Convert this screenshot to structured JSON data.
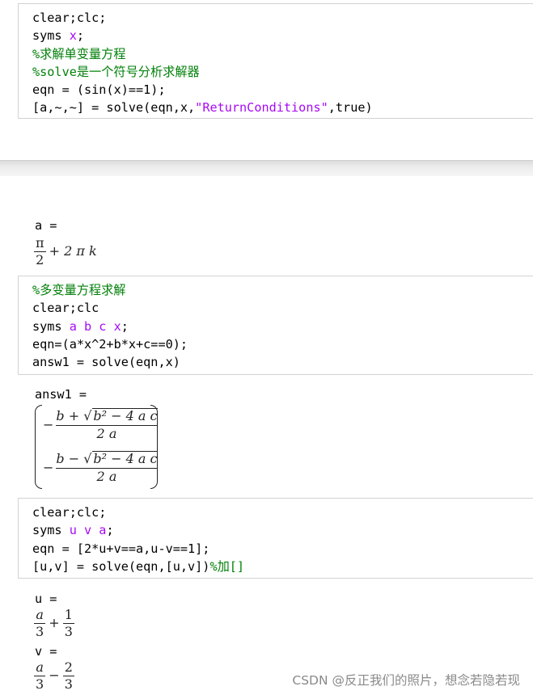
{
  "cell1": {
    "lines": [
      {
        "parts": [
          {
            "t": "clear;clc;",
            "c": ""
          }
        ]
      },
      {
        "parts": [
          {
            "t": "syms ",
            "c": ""
          },
          {
            "t": "x",
            "c": "kw"
          },
          {
            "t": ";",
            "c": ""
          }
        ]
      },
      {
        "parts": [
          {
            "t": "%求解单变量方程",
            "c": "cm"
          }
        ]
      },
      {
        "parts": [
          {
            "t": "%solve是一个符号分析求解器",
            "c": "cm"
          }
        ]
      },
      {
        "parts": [
          {
            "t": "eqn = (sin(x)==1);",
            "c": ""
          }
        ]
      },
      {
        "parts": [
          {
            "t": "[a,~,~] = solve(eqn,x,",
            "c": ""
          },
          {
            "t": "\"ReturnConditions\"",
            "c": "str"
          },
          {
            "t": ",true)",
            "c": ""
          }
        ]
      }
    ]
  },
  "output1": {
    "label": "a =",
    "num": "π",
    "den": "2",
    "rest": "+ 2 π k"
  },
  "cell2": {
    "lines": [
      {
        "parts": [
          {
            "t": "%多变量方程求解",
            "c": "cm"
          }
        ]
      },
      {
        "parts": [
          {
            "t": "clear;clc",
            "c": ""
          }
        ]
      },
      {
        "parts": [
          {
            "t": "syms ",
            "c": ""
          },
          {
            "t": "a b c x",
            "c": "kw"
          },
          {
            "t": ";",
            "c": ""
          }
        ]
      },
      {
        "parts": [
          {
            "t": "eqn=(a*x^2+b*x+c==0);",
            "c": ""
          }
        ]
      },
      {
        "parts": [
          {
            "t": "answ1 = solve(eqn,x)",
            "c": ""
          }
        ]
      }
    ]
  },
  "output2": {
    "label": "answ1 =",
    "row1": {
      "sign": "−",
      "num_pre": "b +",
      "sqrt": "b² − 4 a c",
      "den": "2 a"
    },
    "row2": {
      "sign": "−",
      "num_pre": "b −",
      "sqrt": "b² − 4 a c",
      "den": "2 a"
    }
  },
  "cell3": {
    "lines": [
      {
        "parts": [
          {
            "t": "clear;clc;",
            "c": ""
          }
        ]
      },
      {
        "parts": [
          {
            "t": "syms ",
            "c": ""
          },
          {
            "t": "u v a",
            "c": "kw"
          },
          {
            "t": ";",
            "c": ""
          }
        ]
      },
      {
        "parts": [
          {
            "t": "eqn = [2*u+v==a,u-v==1];",
            "c": ""
          }
        ]
      },
      {
        "parts": [
          {
            "t": "[u,v] = solve(eqn,[u,v])",
            "c": ""
          },
          {
            "t": "%加[]",
            "c": "cm"
          }
        ]
      }
    ]
  },
  "output3": {
    "u_label": "u =",
    "u": {
      "n1": "a",
      "d1": "3",
      "op": "+",
      "n2": "1",
      "d2": "3"
    },
    "v_label": "v =",
    "v": {
      "n1": "a",
      "d1": "3",
      "op": "−",
      "n2": "2",
      "d2": "3"
    }
  },
  "watermark": "CSDN @反正我们的照片，想念若隐若现"
}
